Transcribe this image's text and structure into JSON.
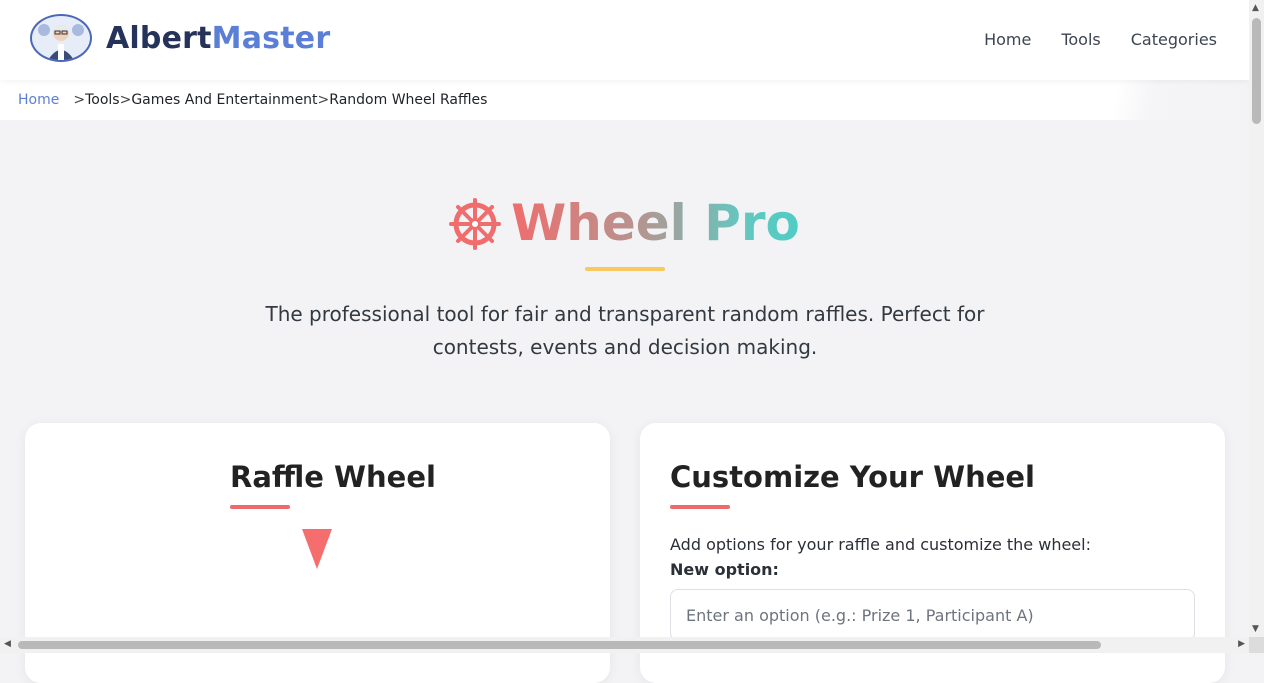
{
  "header": {
    "logo_part1": "Albert",
    "logo_part2": "Master",
    "nav": [
      "Home",
      "Tools",
      "Categories"
    ]
  },
  "breadcrumb": {
    "home": "Home",
    "items": [
      "Tools",
      "Games And Entertainment",
      "Random Wheel Raffles"
    ],
    "separator": ">"
  },
  "hero": {
    "icon": "dharma-wheel-icon",
    "title": "Wheel Pro",
    "subtitle": "The professional tool for fair and transparent random raffles. Perfect for contests, events and decision making."
  },
  "raffle_card": {
    "title": "Raffle Wheel"
  },
  "customize_card": {
    "title": "Customize Your Wheel",
    "description": "Add options for your raffle and customize the wheel:",
    "new_option_label": "New option:",
    "input_placeholder": "Enter an option (e.g.: Prize 1, Participant A)",
    "input_value": ""
  },
  "colors": {
    "brand_dark": "#25335a",
    "brand_light": "#5b7fd6",
    "accent_red": "#f06d6d",
    "accent_teal": "#4ecdc4",
    "accent_yellow": "#f7c95e"
  }
}
